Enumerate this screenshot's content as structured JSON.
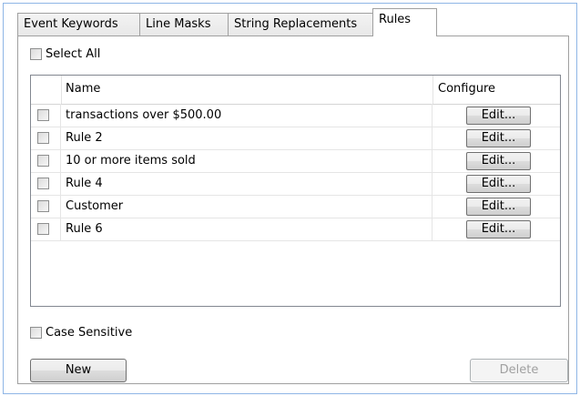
{
  "tabs": [
    {
      "label": "Event Keywords",
      "active": false
    },
    {
      "label": "Line Masks",
      "active": false
    },
    {
      "label": "String Replacements",
      "active": false
    },
    {
      "label": "Rules",
      "active": true
    }
  ],
  "select_all": {
    "label": "Select All",
    "checked": false
  },
  "list": {
    "columns": {
      "name": "Name",
      "configure": "Configure"
    },
    "rows": [
      {
        "name": "transactions over $500.00",
        "checked": false,
        "edit_label": "Edit..."
      },
      {
        "name": "Rule 2",
        "checked": false,
        "edit_label": "Edit..."
      },
      {
        "name": "10 or more items sold",
        "checked": false,
        "edit_label": "Edit..."
      },
      {
        "name": "Rule 4",
        "checked": false,
        "edit_label": "Edit..."
      },
      {
        "name": "Customer",
        "checked": false,
        "edit_label": "Edit..."
      },
      {
        "name": "Rule 6",
        "checked": false,
        "edit_label": "Edit..."
      }
    ]
  },
  "case_sensitive": {
    "label": "Case Sensitive",
    "checked": false
  },
  "buttons": {
    "new_label": "New",
    "delete_label": "Delete",
    "delete_enabled": false
  },
  "colors": {
    "window_border": "#8fb6e6",
    "disabled_text": "#a0a0a0"
  }
}
